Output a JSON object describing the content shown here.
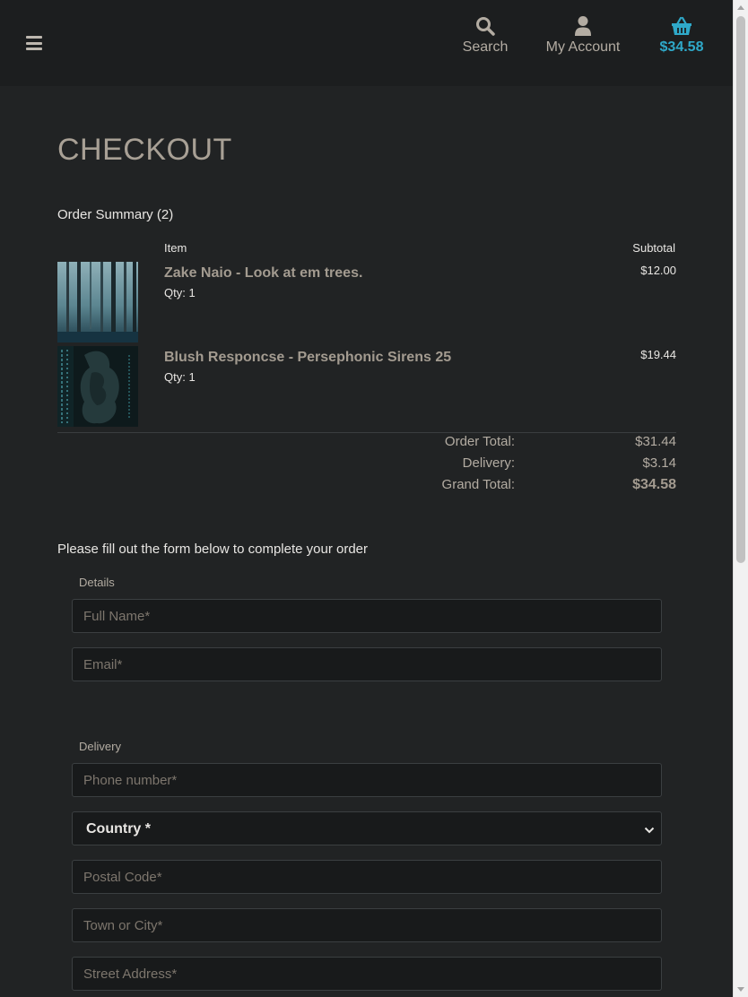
{
  "header": {
    "search_label": "Search",
    "account_label": "My Account",
    "cart_total": "$34.58"
  },
  "page_title": "CHECKOUT",
  "order_summary": {
    "label": "Order Summary (2)",
    "col_item": "Item",
    "col_subtotal": "Subtotal",
    "items": [
      {
        "name": "Zake Naio - Look at em trees.",
        "qty": "Qty: 1",
        "price": "$12.00"
      },
      {
        "name": "Blush Responcse - Persephonic Sirens 25",
        "qty": "Qty: 1",
        "price": "$19.44"
      }
    ],
    "order_total_label": "Order Total:",
    "order_total": "$31.44",
    "delivery_label": "Delivery:",
    "delivery": "$3.14",
    "grand_total_label": "Grand Total:",
    "grand_total": "$34.58"
  },
  "form": {
    "intro": "Please fill out the form below to complete your order",
    "details_legend": "Details",
    "full_name_placeholder": "Full Name*",
    "email_placeholder": "Email*",
    "delivery_legend": "Delivery",
    "phone_placeholder": "Phone number*",
    "country_selected": "Country *",
    "postal_placeholder": "Postal Code*",
    "town_placeholder": "Town or City*",
    "street_placeholder": "Street Address*"
  },
  "colors": {
    "background": "#212324",
    "header": "#1c1e1f",
    "accent": "#2fa9c9"
  }
}
